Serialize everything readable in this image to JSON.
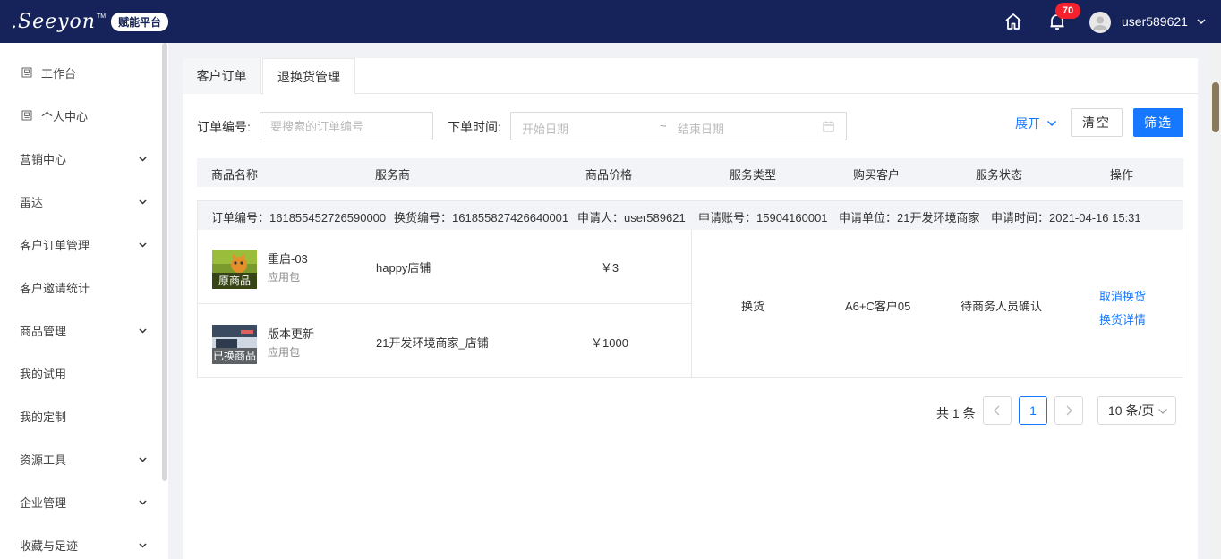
{
  "header": {
    "logo_text": ".Seeyon",
    "logo_tm": "TM",
    "platform_badge": "赋能平台",
    "notification_count": "70",
    "username": "user589621"
  },
  "sidebar": {
    "items": [
      {
        "label": "工作台",
        "icon": "workbench-icon"
      },
      {
        "label": "个人中心",
        "icon": "profile-icon"
      },
      {
        "label": "营销中心",
        "expandable": true
      },
      {
        "label": "雷达",
        "expandable": true
      },
      {
        "label": "客户订单管理",
        "expandable": true
      },
      {
        "label": "客户邀请统计"
      },
      {
        "label": "商品管理",
        "expandable": true
      },
      {
        "label": "我的试用"
      },
      {
        "label": "我的定制"
      },
      {
        "label": "资源工具",
        "expandable": true
      },
      {
        "label": "企业管理",
        "expandable": true
      },
      {
        "label": "收藏与足迹",
        "expandable": true
      }
    ]
  },
  "tabs": [
    {
      "label": "客户订单"
    },
    {
      "label": "退换货管理"
    }
  ],
  "filters": {
    "order_no_label": "订单编号:",
    "order_no_placeholder": "要搜索的订单编号",
    "order_time_label": "下单时间:",
    "start_placeholder": "开始日期",
    "range_sep": "~",
    "end_placeholder": "结束日期",
    "expand_label": "展开",
    "clear_label": "清空",
    "filter_label": "筛选"
  },
  "table": {
    "columns": [
      "商品名称",
      "服务商",
      "商品价格",
      "服务类型",
      "购买客户",
      "服务状态",
      "操作"
    ]
  },
  "order": {
    "order_no": "订单编号：161855452726590000",
    "exchange_no": "换货编号：161855827426640001",
    "applicant": "申请人：user589621",
    "account": "申请账号：15904160001",
    "unit": "申请单位：21开发环境商家",
    "apply_time": "申请时间：2021-04-16 15:31",
    "products": [
      {
        "thumb_caption": "原商品",
        "name": "重启-03",
        "type": "应用包",
        "vendor": "happy店铺",
        "price": "￥3"
      },
      {
        "thumb_caption": "已换商品",
        "name": "版本更新",
        "type": "应用包",
        "vendor": "21开发环境商家_店铺",
        "price": "￥1000"
      }
    ],
    "service_type": "换货",
    "customer": "A6+C客户05",
    "status": "待商务人员确认",
    "actions": [
      "取消换货",
      "换货详情"
    ]
  },
  "pagination": {
    "total": "共 1 条",
    "current_page": "1",
    "page_size": "10 条/页"
  }
}
